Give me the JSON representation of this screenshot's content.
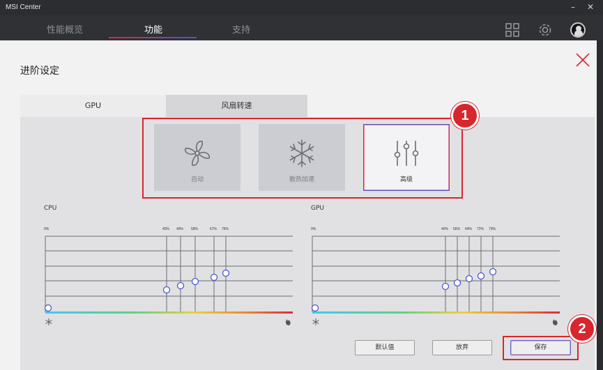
{
  "window": {
    "title": "MSI Center"
  },
  "nav": {
    "tabs": [
      "性能概览",
      "功能",
      "支持"
    ],
    "active_index": 1
  },
  "panel": {
    "title": "进阶设定",
    "tabs": [
      "GPU",
      "风扇转速"
    ],
    "active_tab": 1
  },
  "modes": [
    {
      "label": "自动",
      "icon": "fan-icon",
      "selected": false
    },
    {
      "label": "散热加速",
      "icon": "snowflake-icon",
      "selected": false
    },
    {
      "label": "高级",
      "icon": "sliders-icon",
      "selected": true
    }
  ],
  "curves": {
    "cpu": {
      "label": "CPU",
      "percent_labels": [
        "0%",
        "40%",
        "49%",
        "58%",
        "67%",
        "76%"
      ]
    },
    "gpu": {
      "label": "GPU",
      "percent_labels": [
        "0%",
        "40%",
        "56%",
        "64%",
        "72%",
        "79%"
      ]
    }
  },
  "buttons": {
    "default": "默认值",
    "discard": "放弃",
    "save": "保存"
  },
  "callouts": [
    "1",
    "2"
  ],
  "colors": {
    "accent_red": "#d7262d",
    "accent_blue": "#4b56d6"
  }
}
